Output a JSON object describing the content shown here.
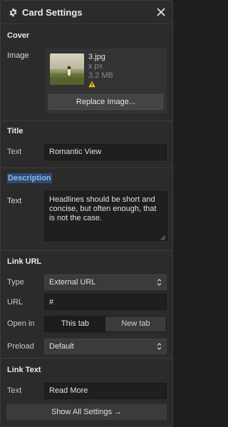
{
  "header": {
    "title": "Card Settings",
    "icon": "gear-icon",
    "close_icon": "close-icon"
  },
  "cover": {
    "section_title": "Cover",
    "image_label": "Image",
    "file_name": "3.jpg",
    "dimensions": "x px",
    "file_size": "3.2 MB",
    "warning_icon": "warning-icon",
    "replace_button": "Replace Image..."
  },
  "title_section": {
    "section_title": "Title",
    "text_label": "Text",
    "text_value": "Romantic View"
  },
  "description": {
    "section_title": "Description",
    "text_label": "Text",
    "text_value": "Headlines should be short and concise, but often enough, that is not the case."
  },
  "link_url": {
    "section_title": "Link URL",
    "type_label": "Type",
    "type_value": "External URL",
    "url_label": "URL",
    "url_value": "#",
    "open_in_label": "Open in",
    "open_in_options": [
      "This tab",
      "New tab"
    ],
    "open_in_selected": "This tab",
    "preload_label": "Preload",
    "preload_value": "Default"
  },
  "link_text": {
    "section_title": "Link Text",
    "text_label": "Text",
    "text_value": "Read More"
  },
  "footer": {
    "show_all_label": "Show All Settings →"
  },
  "colors": {
    "panel_bg": "#2b2b2b",
    "input_bg": "#1f1f1f",
    "highlight_bg": "#2e4b73",
    "highlight_text": "#8fb8ec",
    "warning": "#f5c518"
  }
}
